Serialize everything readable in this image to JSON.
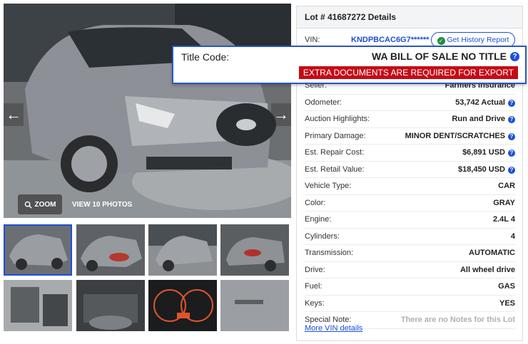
{
  "gallery": {
    "zoom_label": "ZOOM",
    "view_photos_label": "VIEW 10 PHOTOS",
    "prev_arrow": "←",
    "next_arrow": "→"
  },
  "details": {
    "heading": "Lot # 41687272 Details",
    "vin_label": "VIN:",
    "vin_value": "KNDPBCAC6G7******",
    "history_button": "Get History Report",
    "title_code_label": "Title Code:",
    "title_code_value": "WA BILL OF SALE NO TITLE",
    "export_notice": "EXTRA DOCUMENTS ARE REQUIRED FOR EXPORT",
    "rows": [
      {
        "label": "Seller:",
        "value": "Farmers Insurance",
        "help": false
      },
      {
        "label": "Odometer:",
        "value": "53,742 Actual",
        "help": true
      },
      {
        "label": "Auction Highlights:",
        "value": "Run and Drive",
        "help": true
      },
      {
        "label": "Primary Damage:",
        "value": "MINOR DENT/SCRATCHES",
        "help": true
      },
      {
        "label": "Est. Repair Cost:",
        "value": "$6,891 USD",
        "help": true
      },
      {
        "label": "Est. Retail Value:",
        "value": "$18,450 USD",
        "help": true
      },
      {
        "label": "Vehicle Type:",
        "value": "CAR",
        "help": false
      },
      {
        "label": "Color:",
        "value": "GRAY",
        "help": false
      },
      {
        "label": "Engine:",
        "value": "2.4L 4",
        "help": false
      },
      {
        "label": "Cylinders:",
        "value": "4",
        "help": false
      },
      {
        "label": "Transmission:",
        "value": "AUTOMATIC",
        "help": false
      },
      {
        "label": "Drive:",
        "value": "All wheel drive",
        "help": false
      },
      {
        "label": "Fuel:",
        "value": "GAS",
        "help": false
      },
      {
        "label": "Keys:",
        "value": "YES",
        "help": false
      },
      {
        "label": "Special Note:",
        "value": "There are no Notes for this Lot",
        "help": false
      }
    ],
    "more_vin_link": "More VIN details"
  },
  "colors": {
    "link_blue": "#1d4fd8",
    "alert_red": "#c40c16",
    "check_green": "#1e8f3e"
  }
}
